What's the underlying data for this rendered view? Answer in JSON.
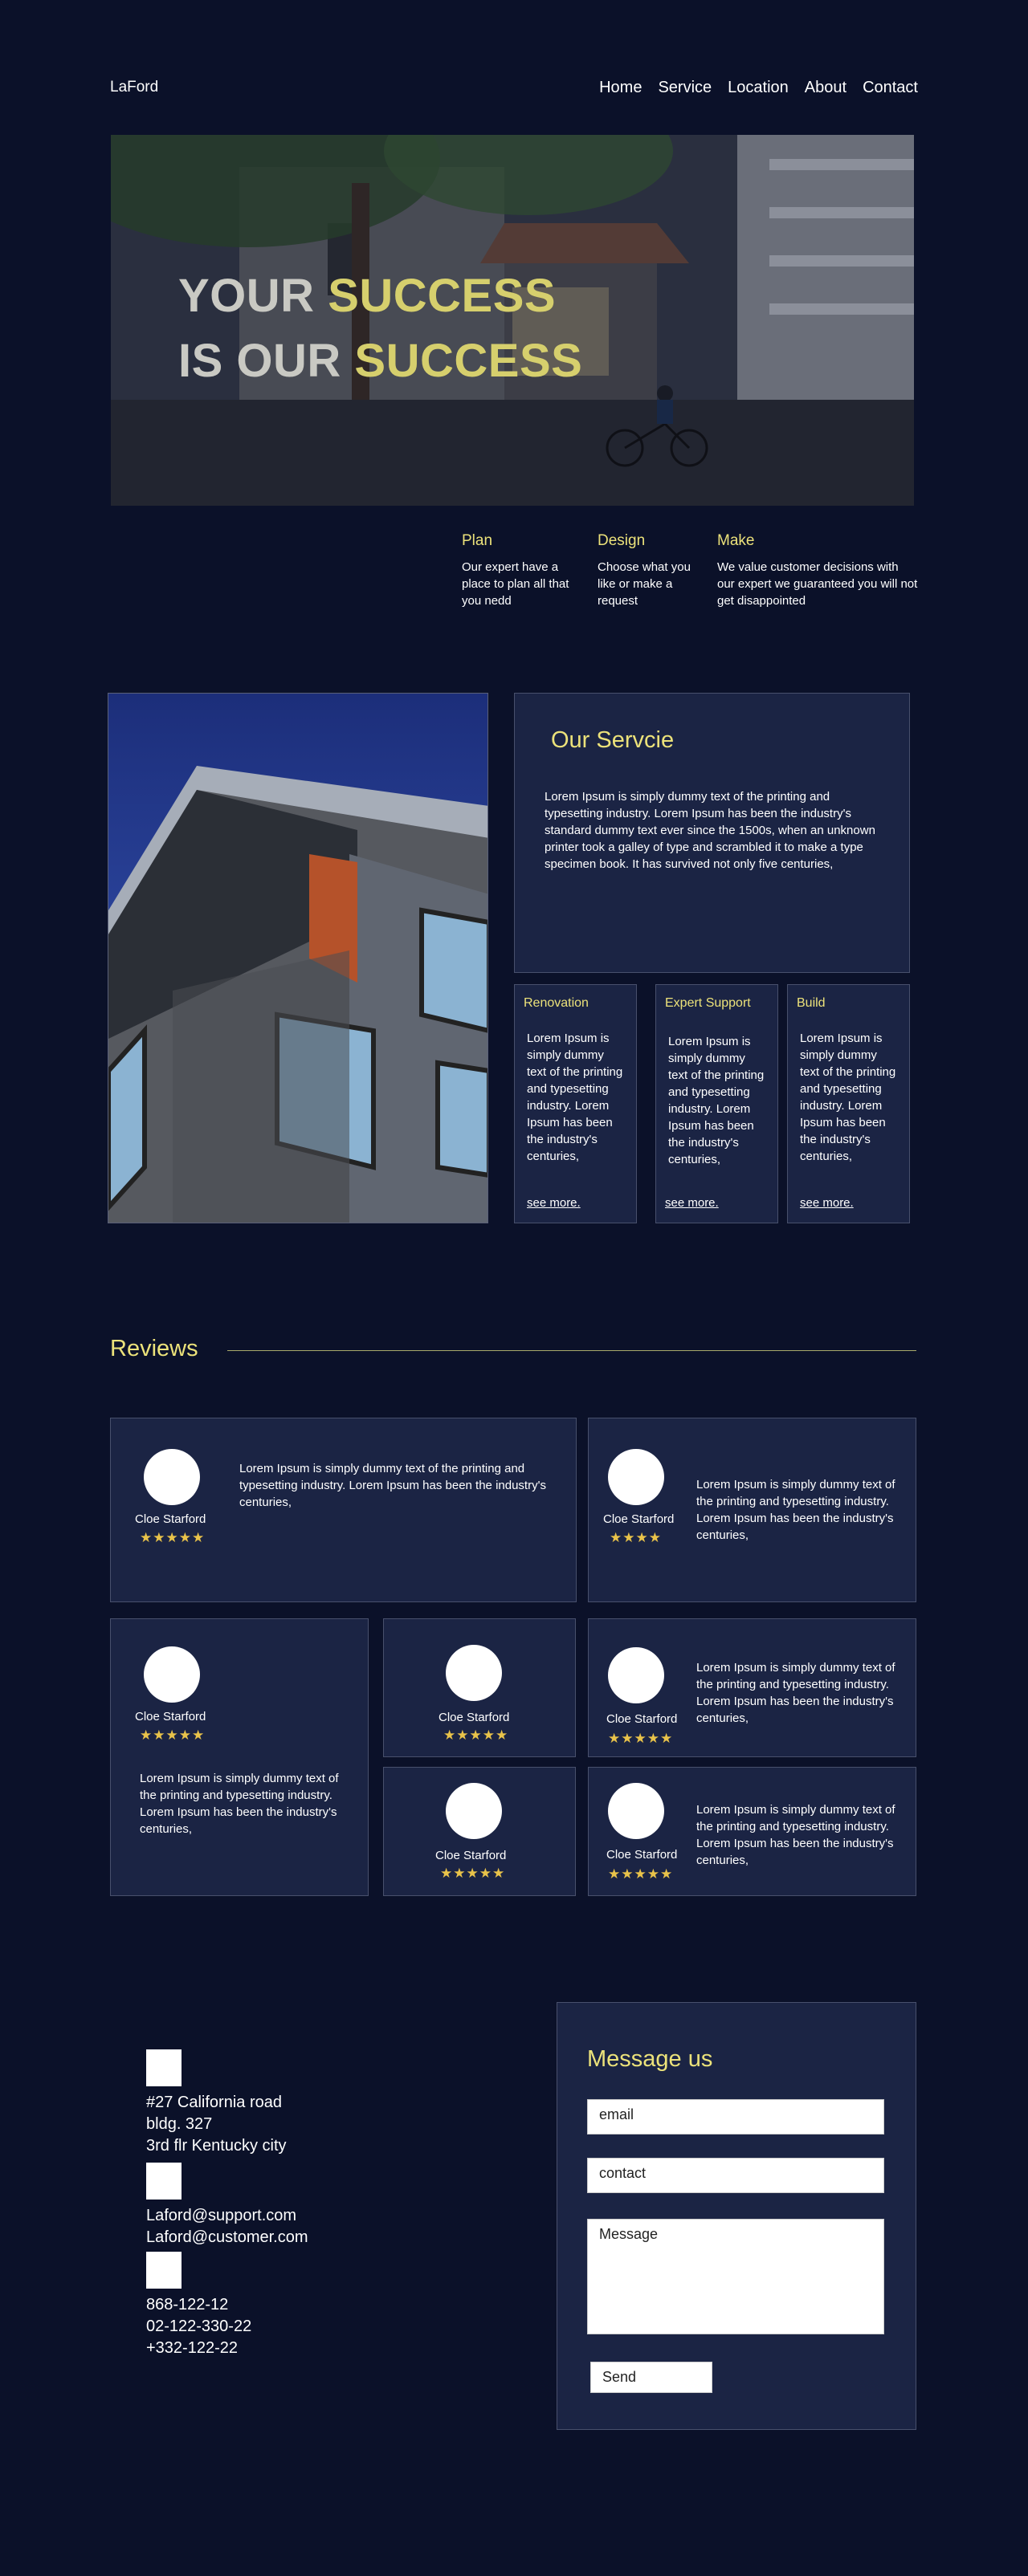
{
  "brand": "LaFord",
  "nav": [
    "Home",
    "Service",
    "Location",
    "About",
    "Contact"
  ],
  "hero": {
    "line1_a": "YOUR ",
    "line1_b": "SUCCESS",
    "line2_a": "IS OUR ",
    "line2_b": "SUCCESS"
  },
  "features": [
    {
      "title": "Plan",
      "text": "Our expert have a place to plan all that you nedd"
    },
    {
      "title": "Design",
      "text": "Choose what you like or make a request"
    },
    {
      "title": "Make",
      "text": "We value customer decisions  with our expert we guaranteed you will not get disappointed"
    }
  ],
  "service": {
    "title": "Our Servcie",
    "text": "Lorem Ipsum is simply dummy text of the printing and typesetting industry. Lorem Ipsum has been the industry's standard dummy text ever since the 1500s, when an unknown printer took a galley of type and scrambled it to make a type specimen book. It has survived not only five centuries,",
    "cards": [
      {
        "title": "Renovation",
        "text": "Lorem Ipsum is simply dummy text of the printing and typesetting industry. Lorem Ipsum has been the industry's centuries,",
        "link": "see more."
      },
      {
        "title": "Expert Support",
        "text": "Lorem Ipsum is simply dummy text of the printing and typesetting industry. Lorem Ipsum has been the industry's centuries,",
        "link": "see more."
      },
      {
        "title": "Build",
        "text": "Lorem Ipsum is simply dummy text of the printing and typesetting industry. Lorem Ipsum has been the industry's centuries,",
        "link": "see more."
      }
    ]
  },
  "reviews": {
    "title": "Reviews",
    "name": "Cloe Starford",
    "short_text": "Lorem Ipsum is simply dummy text of the printing and typesetting industry. Lorem Ipsum has been the industry's centuries,",
    "items": [
      {
        "stars": "★★★★★"
      },
      {
        "stars": "★★★★"
      },
      {
        "stars": "★★★★★"
      },
      {
        "stars": "★★★★★"
      },
      {
        "stars": "★★★★★"
      },
      {
        "stars": "★★★★★"
      },
      {
        "stars": "★★★★★"
      }
    ]
  },
  "contact": {
    "address": [
      "#27 California road",
      "bldg. 327",
      "3rd flr Kentucky city"
    ],
    "emails": [
      "Laford@support.com",
      "Laford@customer.com"
    ],
    "phones": [
      "868-122-12",
      "02-122-330-22",
      "+332-122-22"
    ],
    "form": {
      "title": "Message us",
      "email_placeholder": "email",
      "contact_placeholder": "contact",
      "message_placeholder": "Message",
      "send_label": "Send"
    }
  }
}
